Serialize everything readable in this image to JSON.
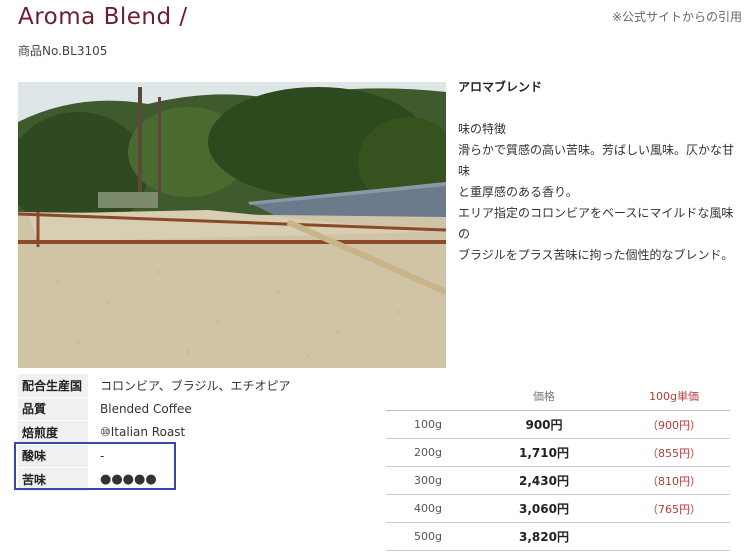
{
  "header": {
    "title": "Aroma Blend /",
    "source_note": "※公式サイトからの引用",
    "product_no": "商品No.BL3105"
  },
  "description": {
    "title": "アロマブレンド",
    "heading": "味の特徴",
    "lines": [
      "滑らかで質感の高い苦味。芳ばしい風味。仄かな甘味",
      "と重厚感のある香り。",
      "エリア指定のコロンビアをベースにマイルドな風味の",
      "ブラジルをプラス苦味に拘った個性的なブレンド。"
    ]
  },
  "specs": [
    {
      "label": "配合生産国",
      "value": "コロンビア、ブラジル、エチオピア"
    },
    {
      "label": "品質",
      "value": "Blended Coffee"
    },
    {
      "label": "焙煎度",
      "value": "⑩Italian Roast"
    },
    {
      "label": "酸味",
      "value": "-"
    },
    {
      "label": "苦味",
      "value": "●●●●●"
    }
  ],
  "price_table": {
    "headers": {
      "weight": "",
      "price": "価格",
      "unit": "100g単価"
    },
    "rows": [
      {
        "weight": "100g",
        "price": "900円",
        "unit": "（900円）"
      },
      {
        "weight": "200g",
        "price": "1,710円",
        "unit": "（855円）"
      },
      {
        "weight": "300g",
        "price": "2,430円",
        "unit": "（810円）"
      },
      {
        "weight": "400g",
        "price": "3,060円",
        "unit": "（765円）"
      },
      {
        "weight": "500g",
        "price": "3,820円",
        "unit": ""
      }
    ]
  },
  "colors": {
    "title": "#6b1f2a",
    "unit_price": "#b33a3a",
    "highlight_border": "#3a46a8"
  }
}
